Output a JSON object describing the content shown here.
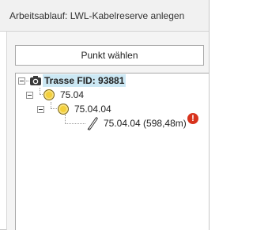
{
  "header": {
    "title": "Arbeitsablauf: LWL-Kabelreserve anlegen"
  },
  "toolbar": {
    "select_point_label": "Punkt wählen"
  },
  "tree": {
    "nodes": [
      {
        "label": "Trasse FID: 93881",
        "icon": "camera-icon",
        "selected": true
      },
      {
        "label": "75.04",
        "icon": "coin-icon"
      },
      {
        "label": "75.04.04",
        "icon": "coin-icon"
      },
      {
        "label": "75.04.04 (598,48m)",
        "icon": "cable-icon"
      }
    ]
  },
  "status": {
    "icon": "error-icon",
    "glyph": "!",
    "color": "#d8331d"
  }
}
